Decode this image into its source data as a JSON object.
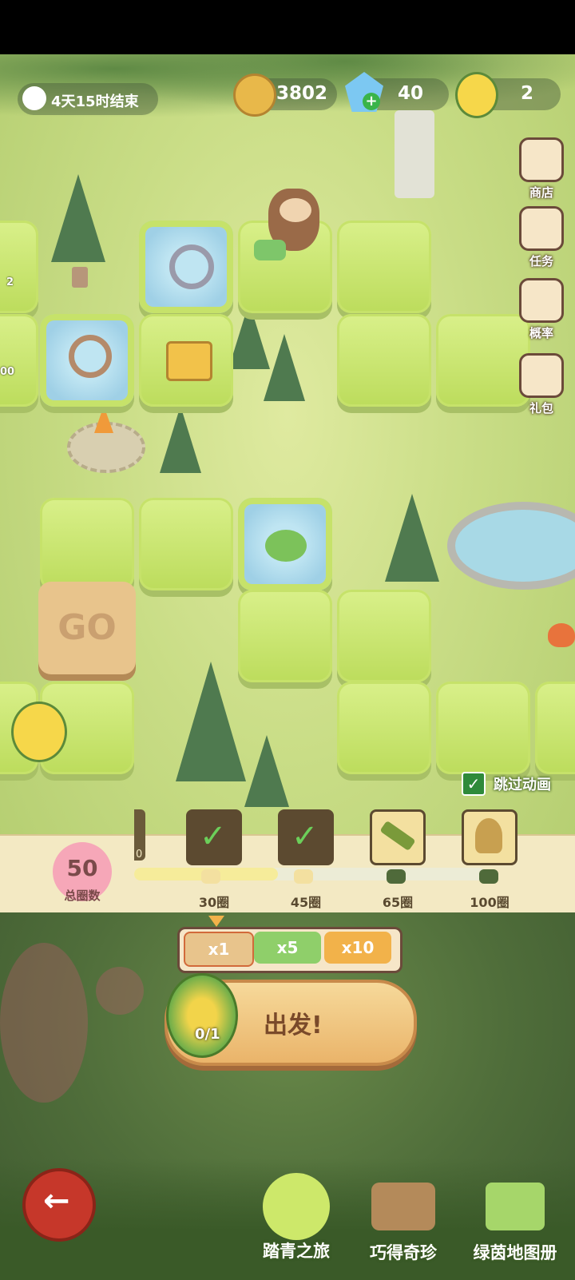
{
  "event": {
    "countdown": "4天15时结束"
  },
  "currency": {
    "coins": "3802",
    "crystals": "40",
    "honey_jars": "2"
  },
  "side_menu": [
    {
      "label": "商店",
      "icon": "shop-icon"
    },
    {
      "label": "任务",
      "icon": "task-icon"
    },
    {
      "label": "概率",
      "icon": "probability-icon"
    },
    {
      "label": "礼包",
      "icon": "gift-icon"
    }
  ],
  "board": {
    "start_tile": "GO",
    "partial_labels": [
      "2",
      "00"
    ]
  },
  "skip_animation": {
    "label": "跳过动画",
    "checked": true
  },
  "progress": {
    "total_laps": "50",
    "total_laps_label": "总圈数",
    "partial_prev_milestone": "0",
    "milestones": [
      {
        "label": "30圈",
        "claimed": true,
        "reward": "boomerang"
      },
      {
        "label": "45圈",
        "claimed": true,
        "reward": "badge"
      },
      {
        "label": "65圈",
        "claimed": false,
        "reward": "bazooka"
      },
      {
        "label": "100圈",
        "claimed": false,
        "reward": "explorer-avatar"
      }
    ],
    "fill_fraction": 0.41
  },
  "multipliers": [
    "x1",
    "x5",
    "x10"
  ],
  "selected_multiplier": "x1",
  "go_button": {
    "label": "出发!",
    "ticket_count": "0/1"
  },
  "bottom_nav": [
    {
      "label": "踏青之旅",
      "active": true
    },
    {
      "label": "巧得奇珍",
      "active": false
    },
    {
      "label": "绿茵地图册",
      "active": false
    }
  ],
  "colors": {
    "tile_green": "#c9e36a",
    "band": "#f3e9c3",
    "go_button": "#f2c77a",
    "back_button": "#c6372a",
    "pink_badge": "#f6a7b8"
  }
}
